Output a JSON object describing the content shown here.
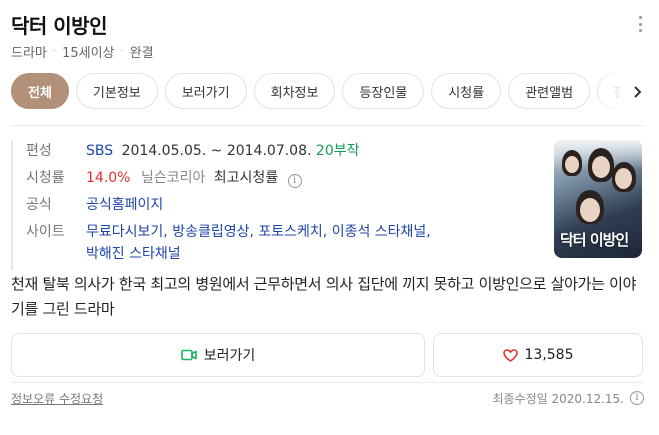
{
  "header": {
    "title": "닥터 이방인",
    "meta": [
      "드라마",
      "15세이상",
      "완결"
    ]
  },
  "tabs": [
    "전체",
    "기본정보",
    "보러가기",
    "회차정보",
    "등장인물",
    "시청률",
    "관련앨범",
    "함"
  ],
  "info": {
    "broadcast": {
      "label": "편성",
      "channel": "SBS",
      "period": "2014.05.05. ~ 2014.07.08.",
      "episodes": "20부작"
    },
    "rating": {
      "label": "시청률",
      "value": "14.0%",
      "source": "닐슨코리아",
      "note": "최고시청률"
    },
    "official": {
      "label": "공식",
      "link": "공식홈페이지"
    },
    "sites": {
      "label": "사이트",
      "links": [
        "무료다시보기,",
        "방송클립영상,",
        "포토스케치,",
        "이종석 스타채널,",
        "박해진 스타채널"
      ]
    }
  },
  "poster": {
    "title": "닥터 이방인"
  },
  "description": "천재 탈북 의사가 한국 최고의 병원에서 근무하면서 의사 집단에 끼지 못하고 이방인으로 살아가는 이야기를 그린 드라마",
  "actions": {
    "watch_label": "보러가기",
    "like_count": "13,585"
  },
  "footer": {
    "report_label": "정보오류 수정요청",
    "updated": "최종수정일 2020.12.15."
  },
  "colors": {
    "active_tab": "#b39078",
    "link": "#1e46a8",
    "rating": "#e0322b",
    "episodes": "#139d5b",
    "watch_icon": "#1fb45f",
    "heart_icon": "#e0322b"
  },
  "icons": {
    "more": "more-vertical-icon",
    "next": "chevron-right-icon",
    "info": "info-icon",
    "watch": "video-camera-icon",
    "like": "heart-icon"
  }
}
